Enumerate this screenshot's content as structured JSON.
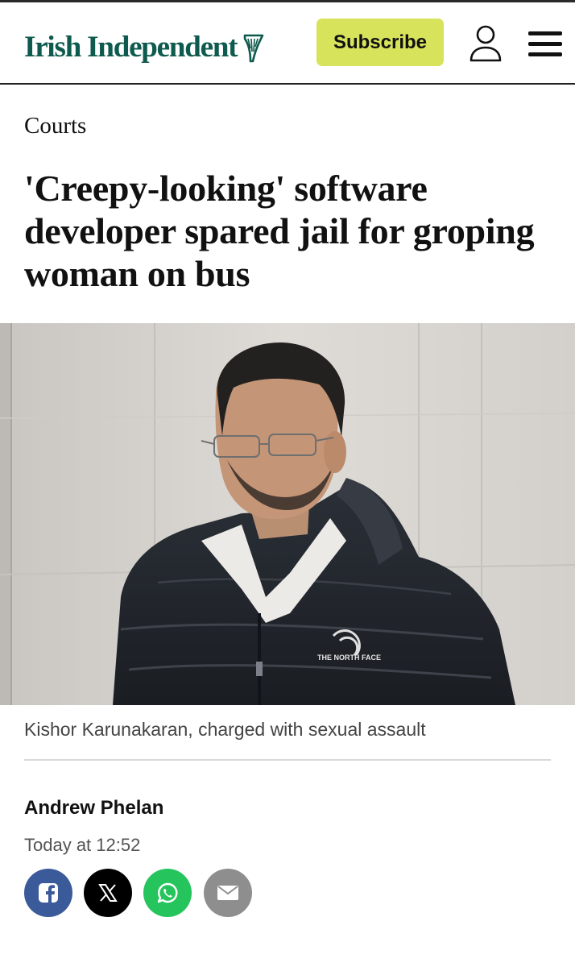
{
  "header": {
    "logo_text": "Irish Independent",
    "subscribe_label": "Subscribe"
  },
  "article": {
    "section": "Courts",
    "headline": "'Creepy-looking' software developer spared jail for groping woman on bus",
    "photo_alt": "Kishor Karunakaran",
    "caption": "Kishor Karunakaran, charged with sexual assault",
    "author": "Andrew Phelan",
    "timestamp": "Today at 12:52",
    "jacket_brand": "THE NORTH FACE"
  },
  "share": {
    "icons": [
      "facebook-icon",
      "x-icon",
      "whatsapp-icon",
      "email-icon"
    ]
  },
  "colors": {
    "brand_green": "#0f5a4e",
    "subscribe_bg": "#d7e35a",
    "facebook": "#3a5a9a",
    "x": "#000000",
    "whatsapp": "#25c45d",
    "email": "#8e8e8e"
  }
}
